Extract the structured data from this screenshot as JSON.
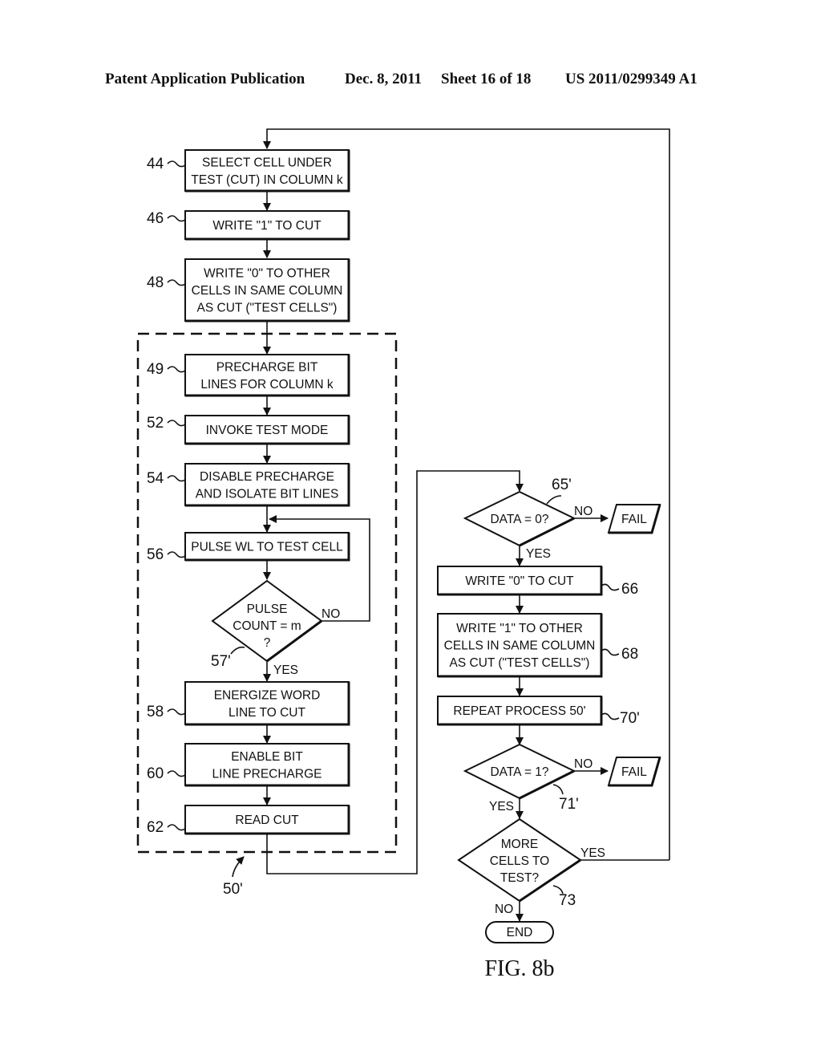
{
  "header": {
    "publication": "Patent Application Publication",
    "date": "Dec. 8, 2011",
    "sheet": "Sheet 16 of 18",
    "number": "US 2011/0299349 A1"
  },
  "figure_label": "FIG. 8b",
  "group": {
    "ref": "50'"
  },
  "steps": [
    {
      "id": "44",
      "lines": [
        "SELECT CELL UNDER",
        "TEST (CUT) IN COLUMN k"
      ]
    },
    {
      "id": "46",
      "lines": [
        "WRITE \"1\" TO CUT"
      ]
    },
    {
      "id": "48",
      "lines": [
        "WRITE \"0\" TO OTHER",
        "CELLS IN SAME COLUMN",
        "AS CUT (\"TEST CELLS\")"
      ]
    },
    {
      "id": "49",
      "lines": [
        "PRECHARGE BIT",
        "LINES FOR COLUMN k"
      ]
    },
    {
      "id": "52",
      "lines": [
        "INVOKE TEST MODE"
      ]
    },
    {
      "id": "54",
      "lines": [
        "DISABLE PRECHARGE",
        "AND ISOLATE BIT LINES"
      ]
    },
    {
      "id": "56",
      "lines": [
        "PULSE WL TO TEST CELL"
      ]
    },
    {
      "id": "58",
      "lines": [
        "ENERGIZE WORD",
        "LINE TO CUT"
      ]
    },
    {
      "id": "60",
      "lines": [
        "ENABLE BIT",
        "LINE PRECHARGE"
      ]
    },
    {
      "id": "62",
      "lines": [
        "READ CUT"
      ]
    },
    {
      "id": "66",
      "lines": [
        "WRITE \"0\" TO CUT"
      ]
    },
    {
      "id": "68",
      "lines": [
        "WRITE \"1\" TO OTHER",
        "CELLS IN SAME COLUMN",
        "AS CUT (\"TEST CELLS\")"
      ]
    },
    {
      "id": "70'",
      "lines": [
        "REPEAT PROCESS 50'"
      ]
    }
  ],
  "decisions": [
    {
      "id": "57'",
      "lines": [
        "PULSE",
        "COUNT = m",
        "?"
      ],
      "yes": "YES",
      "no": "NO"
    },
    {
      "id": "65'",
      "lines": [
        "DATA = 0?"
      ],
      "yes": "YES",
      "no": "NO"
    },
    {
      "id": "71'",
      "lines": [
        "DATA = 1?"
      ],
      "yes": "YES",
      "no": "NO"
    },
    {
      "id": "73",
      "lines": [
        "MORE",
        "CELLS TO",
        "TEST?"
      ],
      "yes": "YES",
      "no": "NO"
    }
  ],
  "terminals": {
    "fail_1": "FAIL",
    "fail_2": "FAIL",
    "end": "END"
  }
}
